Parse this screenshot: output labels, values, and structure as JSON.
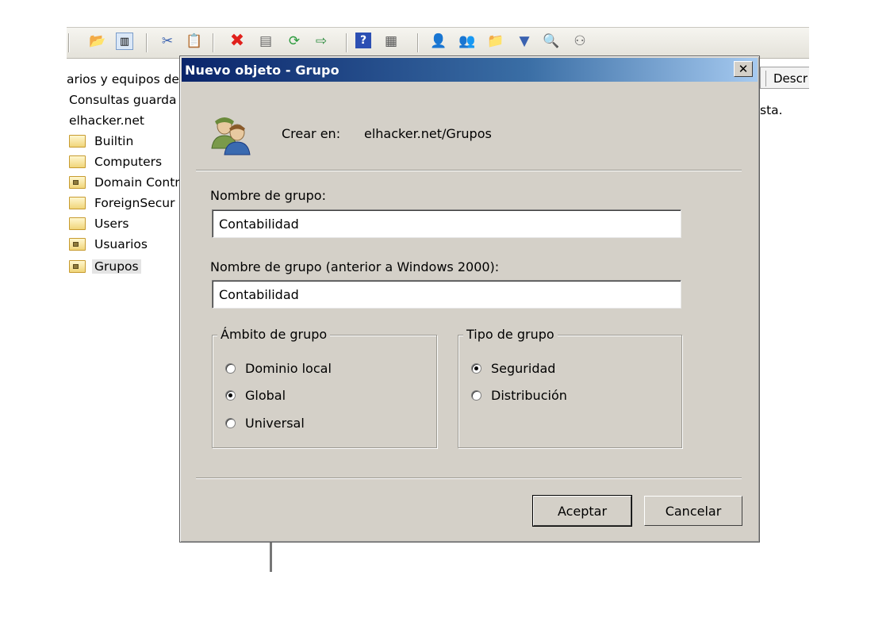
{
  "toolbar": {
    "icons": [
      "up-folder-icon",
      "show-hide-tree-icon",
      "cut-icon",
      "copy-icon",
      "delete-icon",
      "properties-icon",
      "refresh-icon",
      "export-list-icon",
      "help-icon",
      "console-icon",
      "new-user-icon",
      "new-group-icon",
      "new-ou-icon",
      "filter-icon",
      "find-icon",
      "add-to-group-icon"
    ]
  },
  "tree": {
    "items": [
      {
        "label": "arios y equipos de",
        "icon": "none"
      },
      {
        "label": "Consultas guarda",
        "icon": "none"
      },
      {
        "label": "elhacker.net",
        "icon": "none"
      },
      {
        "label": "Builtin",
        "icon": "folder"
      },
      {
        "label": "Computers",
        "icon": "folder"
      },
      {
        "label": "Domain Contr",
        "icon": "ou-folder"
      },
      {
        "label": "ForeignSecur",
        "icon": "folder"
      },
      {
        "label": "Users",
        "icon": "folder"
      },
      {
        "label": "Usuarios",
        "icon": "ou-folder"
      },
      {
        "label": "Grupos",
        "icon": "ou-folder"
      }
    ]
  },
  "right_pane": {
    "column_header": "Descr",
    "text": "sta."
  },
  "dialog": {
    "title": "Nuevo objeto - Grupo",
    "close_label": "✕",
    "create_in_label": "Crear en:",
    "create_in_value": "elhacker.net/Grupos",
    "group_name_label": "Nombre de grupo:",
    "group_name_value": "Contabilidad",
    "group_name_pre2000_label": "Nombre de grupo (anterior a Windows 2000):",
    "group_name_pre2000_value": "Contabilidad",
    "scope": {
      "legend": "Ámbito de grupo",
      "options": [
        {
          "label": "Dominio local",
          "checked": false
        },
        {
          "label": "Global",
          "checked": true
        },
        {
          "label": "Universal",
          "checked": false
        }
      ]
    },
    "type": {
      "legend": "Tipo de grupo",
      "options": [
        {
          "label": "Seguridad",
          "checked": true
        },
        {
          "label": "Distribución",
          "checked": false
        }
      ]
    },
    "ok_label": "Aceptar",
    "cancel_label": "Cancelar"
  }
}
